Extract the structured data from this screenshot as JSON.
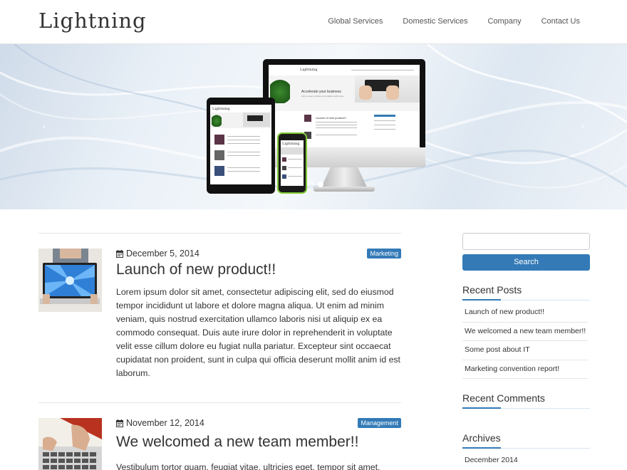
{
  "site": {
    "logo": "Lightning"
  },
  "nav": [
    {
      "label": "Global Services"
    },
    {
      "label": "Domestic Services"
    },
    {
      "label": "Company"
    },
    {
      "label": "Contact Us"
    }
  ],
  "hero": {
    "prev_icon": "chevron-left-icon",
    "next_icon": "chevron-right-icon",
    "slides_total": 2,
    "active_slide": 2,
    "mock": {
      "desktop_title": "Lightning",
      "tablet_title": "Lightning",
      "phone_title": "Lightning",
      "desktop_headline": "Accelerate your business",
      "desktop_tagline": "with an easy website and reliable technology",
      "desktop_post_title": "Launch of new product!!"
    }
  },
  "posts": [
    {
      "date": "December 5, 2014",
      "category": "Marketing",
      "title": "Launch of new product!!",
      "excerpt": "Lorem ipsum dolor sit amet, consectetur adipiscing elit, sed do eiusmod tempor incididunt ut labore et dolore magna aliqua. Ut enim ad minim veniam, quis nostrud exercitation ullamco laboris nisi ut aliquip ex ea commodo consequat. Duis aute irure dolor in reprehenderit in voluptate velit esse cillum dolore eu fugiat nulla pariatur. Excepteur sint occaecat cupidatat non proident, sunt in culpa qui officia deserunt mollit anim id est laborum."
    },
    {
      "date": "November 12, 2014",
      "category": "Management",
      "title": "We welcomed a new team member!!",
      "excerpt": "Vestibulum tortor quam, feugiat vitae, ultricies eget, tempor sit amet,"
    }
  ],
  "sidebar": {
    "search_button": "Search",
    "search_value": "",
    "recent_posts_title": "Recent Posts",
    "recent_posts": [
      "Launch of new product!!",
      "We welcomed a new team member!!",
      "Some post about IT",
      "Marketing convention report!"
    ],
    "recent_comments_title": "Recent Comments",
    "archives_title": "Archives",
    "archives": [
      "December 2014"
    ]
  },
  "colors": {
    "accent": "#337ab7",
    "text": "#333333",
    "divider": "#e5e5e5"
  }
}
